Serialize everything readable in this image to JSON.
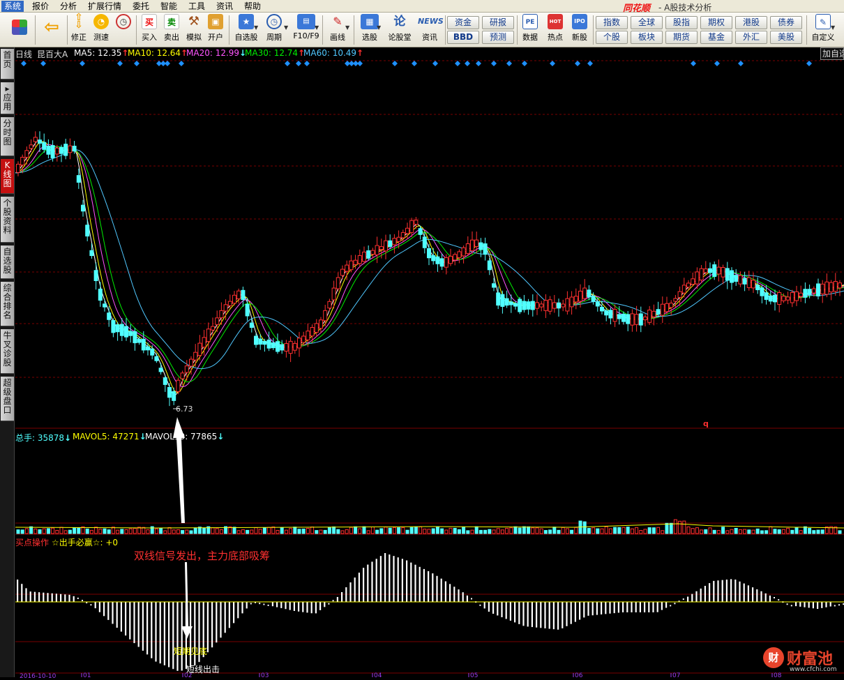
{
  "menu": [
    "系统",
    "报价",
    "分析",
    "扩展行情",
    "委托",
    "智能",
    "工具",
    "资讯",
    "帮助"
  ],
  "brand": {
    "logo_text": "同花顺",
    "subtitle": "- A股技术分析"
  },
  "toolbar": {
    "buttons": [
      {
        "label": "",
        "icon": "grid-icon"
      },
      {
        "label": "",
        "icon": "back-arrow-icon"
      },
      {
        "label": "修正",
        "icon": "modify-icon"
      },
      {
        "label": "测速",
        "icon": "speed-test-icon"
      },
      {
        "label": "买入",
        "icon": "buy-icon",
        "glyph": "买"
      },
      {
        "label": "卖出",
        "icon": "sell-icon",
        "glyph": "卖"
      },
      {
        "label": "模拟",
        "icon": "simulate-icon"
      },
      {
        "label": "开户",
        "icon": "open-account-icon"
      },
      {
        "label": "自选股",
        "icon": "watchlist-icon"
      },
      {
        "label": "周期",
        "icon": "period-icon"
      },
      {
        "label": "F10/F9",
        "icon": "f10-icon"
      },
      {
        "label": "画线",
        "icon": "draw-line-icon"
      },
      {
        "label": "选股",
        "icon": "stock-picker-icon"
      },
      {
        "label": "论股堂",
        "icon": "forum-icon",
        "glyph": "论"
      },
      {
        "label": "资讯",
        "icon": "news-icon",
        "glyph": "NEWS"
      },
      {
        "label": "数据",
        "icon": "data-icon",
        "glyph": "PE"
      },
      {
        "label": "热点",
        "icon": "hot-icon",
        "glyph": "HOT"
      },
      {
        "label": "新股",
        "icon": "ipo-icon",
        "glyph": "IPO"
      },
      {
        "label": "自定义",
        "icon": "customize-icon"
      }
    ],
    "grid_buttons": [
      "资金",
      "研报",
      "BBD",
      "预测",
      "指数",
      "全球",
      "股指",
      "期权",
      "港股",
      "债券",
      "个股",
      "板块",
      "期货",
      "基金",
      "外汇",
      "美股"
    ]
  },
  "sidebar": [
    {
      "label": "首页"
    },
    {
      "label": "应用"
    },
    {
      "label": "分时图"
    },
    {
      "label": "K线图"
    },
    {
      "label": "个股资料"
    },
    {
      "label": "自选股"
    },
    {
      "label": "综合排名"
    },
    {
      "label": "牛叉诊股"
    },
    {
      "label": "超级盘口"
    }
  ],
  "kline": {
    "period": "日线",
    "stock": "昆百大A",
    "ma": [
      {
        "label": "MA5: 12.35",
        "arrow": "↑",
        "color": "#ffffff",
        "arrow_color": "#ff3030"
      },
      {
        "label": "MA10: 12.64",
        "arrow": "↑",
        "color": "#ffff00",
        "arrow_color": "#ff3030"
      },
      {
        "label": "MA20: 12.99",
        "arrow": "↓",
        "color": "#ff55ff",
        "arrow_color": "#50ffff"
      },
      {
        "label": "MA30: 12.74",
        "arrow": "↑",
        "color": "#00ee00",
        "arrow_color": "#ff3030"
      },
      {
        "label": "MA60: 10.49",
        "arrow": "↑",
        "color": "#50c8ff",
        "arrow_color": "#ff3030"
      }
    ],
    "add_button": "加自选",
    "low_label": "6.73",
    "marker_q": "q"
  },
  "volume": {
    "items": [
      {
        "label": "总手: 35878",
        "arrow": "↓",
        "color": "#50ffff"
      },
      {
        "label": "MAVOL5: 47271",
        "arrow": "↓",
        "color": "#ffff00"
      },
      {
        "label": "MAVOL10: 77865",
        "arrow": "↓",
        "color": "#ffffff"
      }
    ]
  },
  "indicator": {
    "name": "买点操作",
    "formula": "☆出手必赢☆: +0",
    "annotation_top": "双线信号发出，主力底部吸筹",
    "annotation_bottom": "短期见底",
    "annotation_sell": "短线出击"
  },
  "date_axis": {
    "first": "2016-10-10",
    "ticks": [
      "01",
      "02",
      "03",
      "04",
      "05",
      "06",
      "07",
      "08"
    ]
  },
  "watermark": {
    "logo_glyph": "财",
    "name": "财富池",
    "url": "www.cfchi.com"
  },
  "colors": {
    "up": "#ff3030",
    "down": "#50ffff",
    "signal": "#1e90ff",
    "grid": "#7a0000"
  }
}
